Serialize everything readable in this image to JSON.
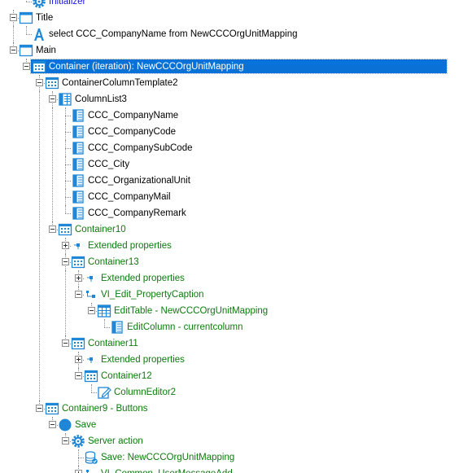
{
  "colors": {
    "selection": "#0a72d6",
    "extended": "#0b7b0b",
    "icon_blue": "#1f87d6"
  },
  "tree": {
    "nodes": [
      {
        "id": "initializer",
        "label": "Initializer",
        "icon": "gear-icon",
        "level": 1,
        "toggle": "none",
        "color": "blue"
      },
      {
        "id": "title",
        "label": "Title",
        "icon": "window-icon",
        "level": 0,
        "toggle": "minus"
      },
      {
        "id": "title-text",
        "label": "select CCC_CompanyName from NewCCCOrgUnitMapping",
        "icon": "text-a-icon",
        "level": 1,
        "toggle": "none"
      },
      {
        "id": "main",
        "label": "Main",
        "icon": "window-icon",
        "level": 0,
        "toggle": "minus"
      },
      {
        "id": "container-iteration",
        "label": "Container (iteration): NewCCCOrgUnitMapping",
        "icon": "grid-icon",
        "level": 1,
        "toggle": "minus",
        "selected": true
      },
      {
        "id": "container-column-template2",
        "label": "ContainerColumnTemplate2",
        "icon": "grid-icon",
        "level": 2,
        "toggle": "minus"
      },
      {
        "id": "columnlist3",
        "label": "ColumnList3",
        "icon": "column-list-icon",
        "level": 3,
        "toggle": "minus"
      },
      {
        "id": "col-companyname",
        "label": "CCC_CompanyName",
        "icon": "column-icon",
        "level": 4,
        "toggle": "none"
      },
      {
        "id": "col-companycode",
        "label": "CCC_CompanyCode",
        "icon": "column-icon",
        "level": 4,
        "toggle": "none"
      },
      {
        "id": "col-companysubcode",
        "label": "CCC_CompanySubCode",
        "icon": "column-icon",
        "level": 4,
        "toggle": "none"
      },
      {
        "id": "col-city",
        "label": "CCC_City",
        "icon": "column-icon",
        "level": 4,
        "toggle": "none"
      },
      {
        "id": "col-orgunit",
        "label": "CCC_OrganizationalUnit",
        "icon": "column-icon",
        "level": 4,
        "toggle": "none"
      },
      {
        "id": "col-companymail",
        "label": "CCC_CompanyMail",
        "icon": "column-icon",
        "level": 4,
        "toggle": "none"
      },
      {
        "id": "col-companyremark",
        "label": "CCC_CompanyRemark",
        "icon": "column-icon",
        "level": 4,
        "toggle": "none"
      },
      {
        "id": "container10",
        "label": "Container10",
        "icon": "grid-icon",
        "level": 3,
        "toggle": "minus",
        "color": "green"
      },
      {
        "id": "extprops-1",
        "label": "Extended properties",
        "icon": "extended-properties-icon",
        "level": 4,
        "toggle": "plus",
        "color": "green"
      },
      {
        "id": "container13",
        "label": "Container13",
        "icon": "grid-icon",
        "level": 4,
        "toggle": "minus",
        "color": "green"
      },
      {
        "id": "extprops-2",
        "label": "Extended properties",
        "icon": "extended-properties-icon",
        "level": 5,
        "toggle": "plus",
        "color": "green"
      },
      {
        "id": "vi-edit-propertycaption",
        "label": "VI_Edit_PropertyCaption",
        "icon": "component-reference-icon",
        "level": 5,
        "toggle": "minus",
        "color": "green"
      },
      {
        "id": "edittable",
        "label": "EditTable - NewCCCOrgUnitMapping",
        "icon": "table-icon",
        "level": 6,
        "toggle": "minus",
        "color": "green"
      },
      {
        "id": "editcolumn",
        "label": "EditColumn - currentcolumn",
        "icon": "column-icon",
        "level": 7,
        "toggle": "none",
        "color": "green"
      },
      {
        "id": "container11",
        "label": "Container11",
        "icon": "grid-icon",
        "level": 4,
        "toggle": "minus",
        "color": "green"
      },
      {
        "id": "extprops-3",
        "label": "Extended properties",
        "icon": "extended-properties-icon",
        "level": 5,
        "toggle": "plus",
        "color": "green"
      },
      {
        "id": "container12",
        "label": "Container12",
        "icon": "grid-icon",
        "level": 5,
        "toggle": "minus",
        "color": "green"
      },
      {
        "id": "columneditor2",
        "label": "ColumnEditor2",
        "icon": "column-editor-icon",
        "level": 6,
        "toggle": "none",
        "color": "green"
      },
      {
        "id": "container9-buttons",
        "label": "Container9 - Buttons",
        "icon": "grid-icon",
        "level": 2,
        "toggle": "minus",
        "color": "green"
      },
      {
        "id": "save",
        "label": "Save",
        "icon": "circle-icon",
        "level": 3,
        "toggle": "minus",
        "color": "green"
      },
      {
        "id": "server-action",
        "label": "Server action",
        "icon": "gear-icon",
        "level": 4,
        "toggle": "minus",
        "color": "green"
      },
      {
        "id": "save-mapping",
        "label": "Save: NewCCCOrgUnitMapping",
        "icon": "database-icon",
        "level": 5,
        "toggle": "none",
        "color": "green"
      },
      {
        "id": "vi-common-usermessageadd",
        "label": "VI_Common_UserMessageAdd",
        "icon": "component-reference-icon",
        "level": 5,
        "toggle": "plus",
        "color": "green"
      }
    ]
  }
}
